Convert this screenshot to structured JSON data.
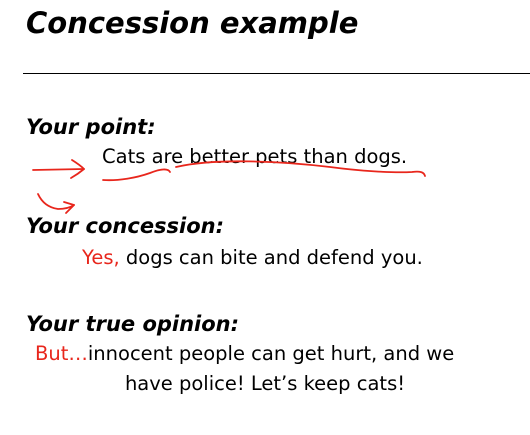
{
  "title": "Concession example",
  "point": {
    "heading": "Your point:",
    "text": "Cats are better pets than dogs."
  },
  "concession": {
    "heading": "Your concession:",
    "lead": "Yes,",
    "text": " dogs can bite and defend you."
  },
  "opinion": {
    "heading": "Your true opinion:",
    "lead": "But…",
    "text": "innocent people can get hurt, and we",
    "line2": "have police! Let’s keep cats!"
  },
  "colors": {
    "accent": "#e8261c",
    "text": "#000000",
    "background": "#ffffff"
  },
  "annotations": [
    "arrow-icon",
    "curved-arrow-icon",
    "underline-scribble"
  ]
}
